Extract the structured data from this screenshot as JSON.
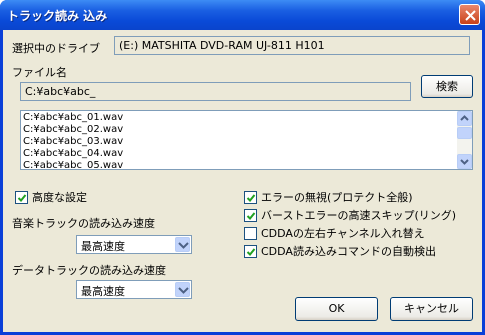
{
  "window": {
    "title": "トラック読み 込み",
    "close_icon": "close-icon"
  },
  "drive": {
    "label": "選択中のドライブ",
    "value": "(E:) MATSHITA DVD-RAM UJ-811 H101"
  },
  "filename": {
    "label": "ファイル名",
    "value": "C:¥abc¥abc_",
    "search_button": "検索"
  },
  "file_list": {
    "items": [
      "C:¥abc¥abc_01.wav",
      "C:¥abc¥abc_02.wav",
      "C:¥abc¥abc_03.wav",
      "C:¥abc¥abc_04.wav",
      "C:¥abc¥abc_05.wav"
    ]
  },
  "advanced": {
    "label": "高度な設定",
    "checked": true
  },
  "music_speed": {
    "label": "音楽トラックの読み込み速度",
    "selected": "最高速度"
  },
  "data_speed": {
    "label": "データトラックの読み込み速度",
    "selected": "最高速度"
  },
  "options": [
    {
      "label": "エラーの無視(プロテクト全般)",
      "checked": true
    },
    {
      "label": "バーストエラーの高速スキップ(リング)",
      "checked": true
    },
    {
      "label": "CDDAの左右チャンネル入れ替え",
      "checked": false
    },
    {
      "label": "CDDA読み込みコマンドの自動検出",
      "checked": true
    }
  ],
  "buttons": {
    "ok": "OK",
    "cancel": "キャンセル"
  },
  "colors": {
    "titlebar": "#0a4ad8",
    "dialog_bg": "#ece9d8",
    "close_button": "#c94119",
    "check_mark": "#21a121"
  }
}
